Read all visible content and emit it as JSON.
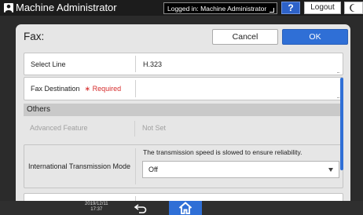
{
  "topbar": {
    "user_name": "Machine Administrator",
    "login_status": "Logged in: Machine Administrator",
    "help_label": "?",
    "logout_label": "Logout",
    "icons": [
      "user-icon",
      "moon-icon"
    ]
  },
  "dialog": {
    "title": "Fax",
    "cancel_label": "Cancel",
    "ok_label": "OK"
  },
  "rows": {
    "select_line": {
      "label": "Select Line",
      "value": "H.323"
    },
    "fax_destination": {
      "label": "Fax Destination",
      "required": "∗ Required",
      "value": ""
    }
  },
  "section": {
    "title": "Others"
  },
  "advanced": {
    "label": "Advanced Feature",
    "value": "Not Set"
  },
  "international": {
    "label": "International Transmission Mode",
    "note": "The transmission speed is slowed to ensure reliability.",
    "selected": "Off"
  },
  "bottombar": {
    "datetime": "2019/12/11\n17:37",
    "icons": [
      "back-icon",
      "home-icon"
    ]
  },
  "colors": {
    "accent": "#2f6fd6",
    "required": "#d62b2b",
    "topbar": "#1c1c1c",
    "dialog_bg": "#e6e6e6"
  }
}
